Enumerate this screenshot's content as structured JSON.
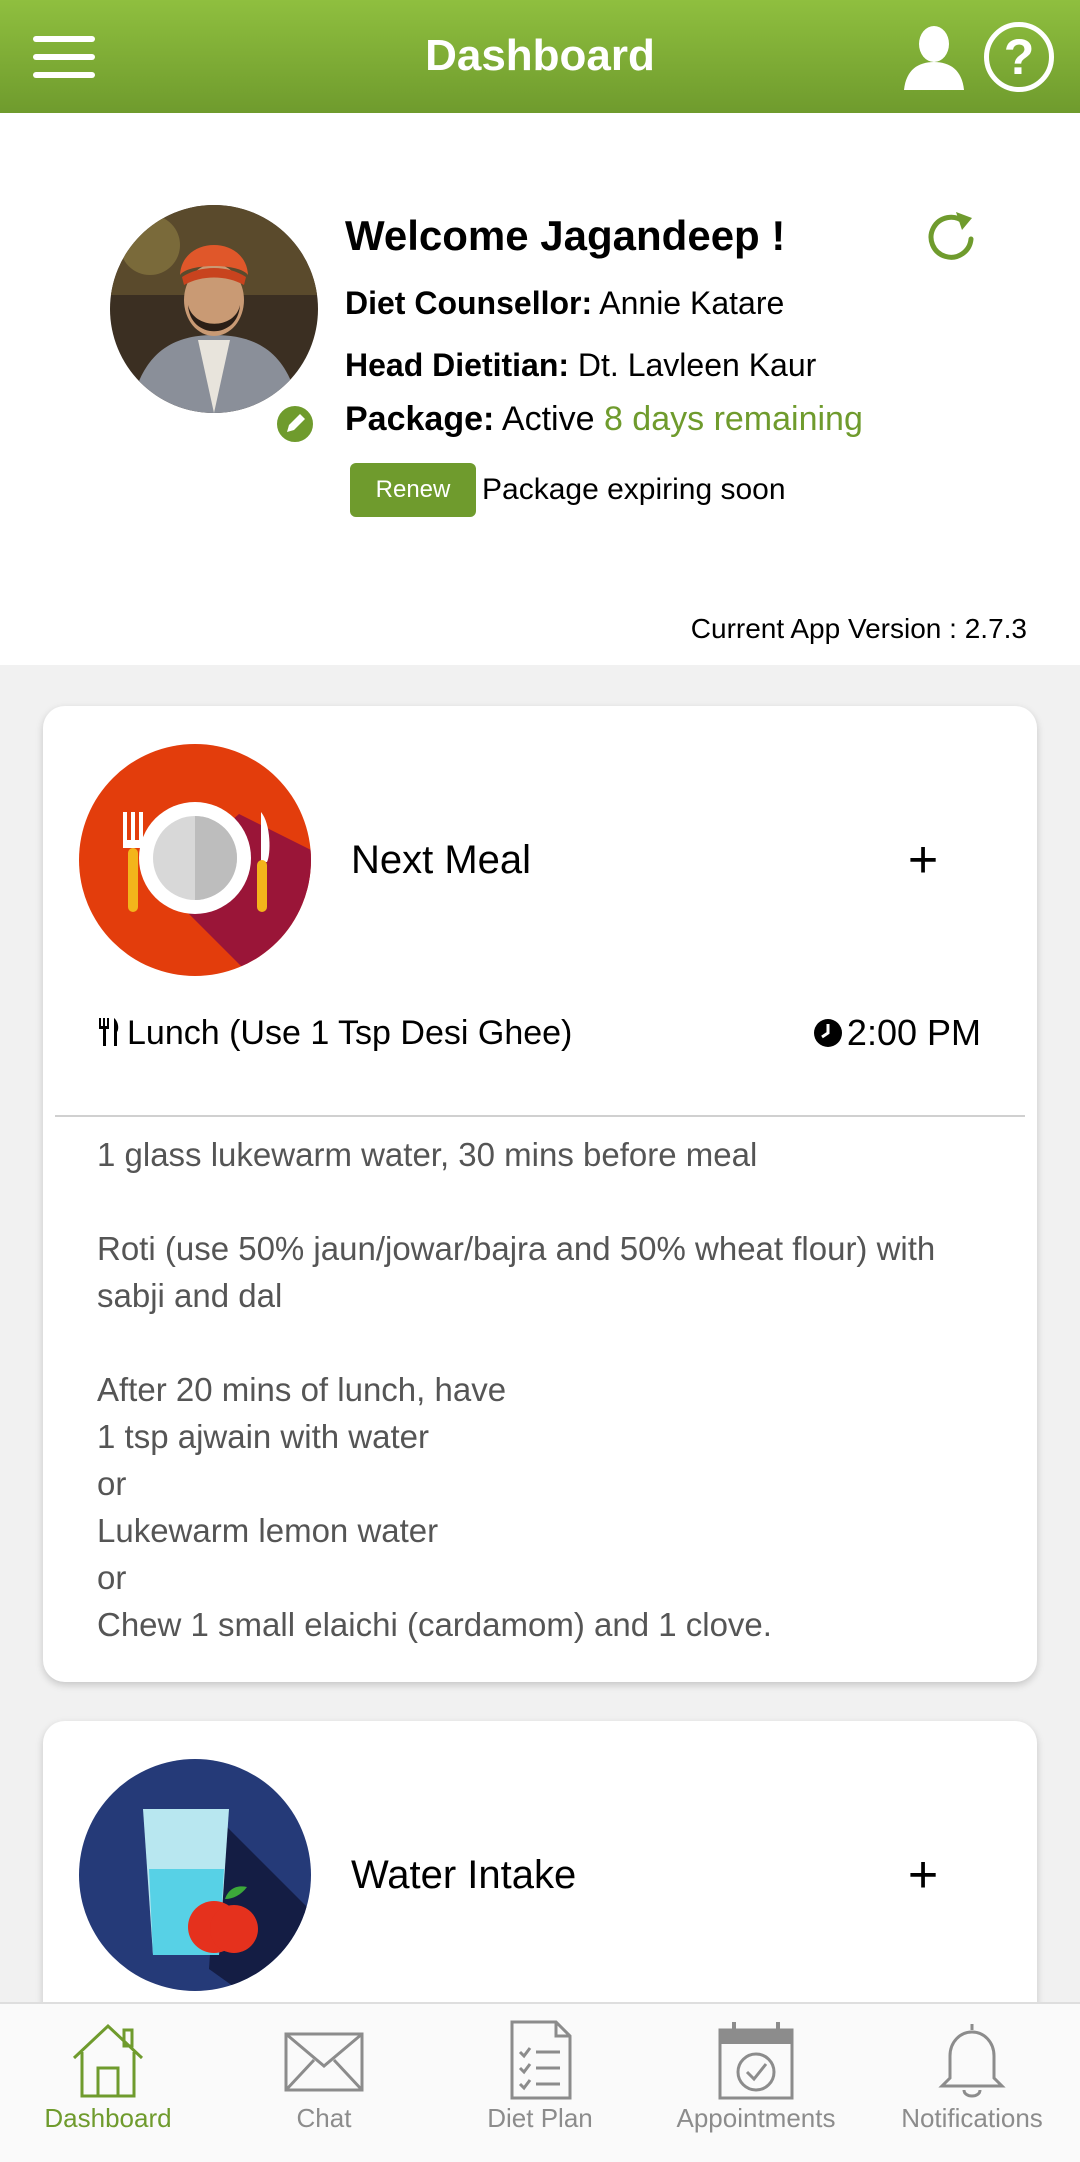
{
  "header": {
    "title": "Dashboard"
  },
  "profile": {
    "welcome": "Welcome Jagandeep !",
    "counsellor_label": "Diet Counsellor:",
    "counsellor_name": "Annie Katare",
    "dietitian_label": "Head Dietitian:",
    "dietitian_name": "Dt. Lavleen Kaur",
    "package_label": "Package:",
    "package_status": "Active",
    "days_remaining": "8 days remaining",
    "renew_label": "Renew",
    "expiry_text": "Package expiring soon",
    "app_version": "Current App Version : 2.7.3"
  },
  "next_meal": {
    "title": "Next Meal",
    "add_label": "+",
    "meal_name": "Lunch (Use 1 Tsp Desi Ghee)",
    "time": "2:00 PM",
    "description": "1 glass lukewarm water, 30 mins before meal\n\nRoti (use 50% jaun/jowar/bajra and 50% wheat flour) with sabji and dal\n\nAfter 20 mins of lunch, have\n1 tsp ajwain with water\nor\nLukewarm lemon water\nor\nChew 1 small elaichi (cardamom) and 1 clove."
  },
  "water_intake": {
    "title": "Water Intake",
    "add_label": "+"
  },
  "nav": [
    {
      "label": "Dashboard",
      "icon": "home-icon"
    },
    {
      "label": "Chat",
      "icon": "envelope-icon"
    },
    {
      "label": "Diet Plan",
      "icon": "checklist-icon"
    },
    {
      "label": "Appointments",
      "icon": "calendar-icon"
    },
    {
      "label": "Notifications",
      "icon": "bell-icon"
    }
  ],
  "colors": {
    "brand_green": "#6f9b2d",
    "meal_icon_bg": "#e33d0c",
    "water_icon_bg": "#253a78"
  }
}
